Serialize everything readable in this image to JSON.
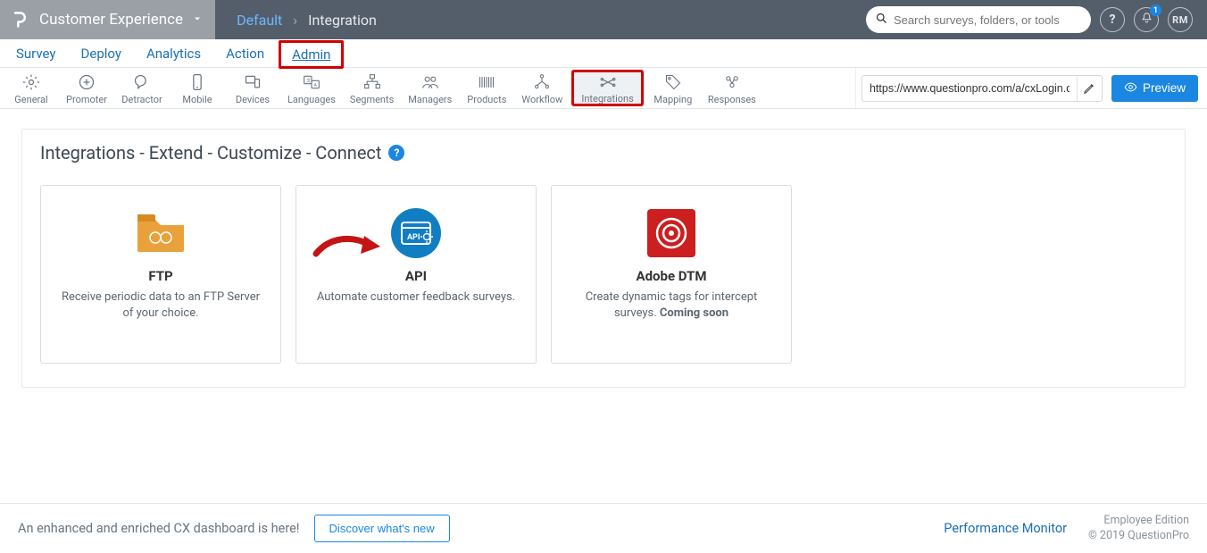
{
  "header": {
    "workspace": "Customer Experience",
    "breadcrumb_default": "Default",
    "breadcrumb_current": "Integration",
    "search_placeholder": "Search surveys, folders, or tools",
    "notification_count": "1",
    "avatar_initials": "RM"
  },
  "primary_tabs": {
    "t0": "Survey",
    "t1": "Deploy",
    "t2": "Analytics",
    "t3": "Action",
    "t4": "Admin"
  },
  "subbar": {
    "b0": "General",
    "b1": "Promoter",
    "b2": "Detractor",
    "b3": "Mobile",
    "b4": "Devices",
    "b5": "Languages",
    "b6": "Segments",
    "b7": "Managers",
    "b8": "Products",
    "b9": "Workflow",
    "b10": "Integrations",
    "b11": "Mapping",
    "b12": "Responses",
    "url": "https://www.questionpro.com/a/cxLogin.d",
    "preview": "Preview"
  },
  "panel": {
    "title": "Integrations - Extend - Customize - Connect"
  },
  "cards": {
    "ftp": {
      "title": "FTP",
      "desc": "Receive periodic data to an FTP Server of your choice."
    },
    "api": {
      "title": "API",
      "desc": "Automate customer feedback surveys."
    },
    "adobe": {
      "title": "Adobe DTM",
      "desc": "Create dynamic tags for intercept surveys.",
      "coming": "Coming soon"
    }
  },
  "footer": {
    "msg": "An enhanced and enriched CX dashboard is here!",
    "discover": "Discover what's new",
    "perf": "Performance Monitor",
    "edition": "Employee Edition",
    "copyright": "© 2019 QuestionPro"
  }
}
